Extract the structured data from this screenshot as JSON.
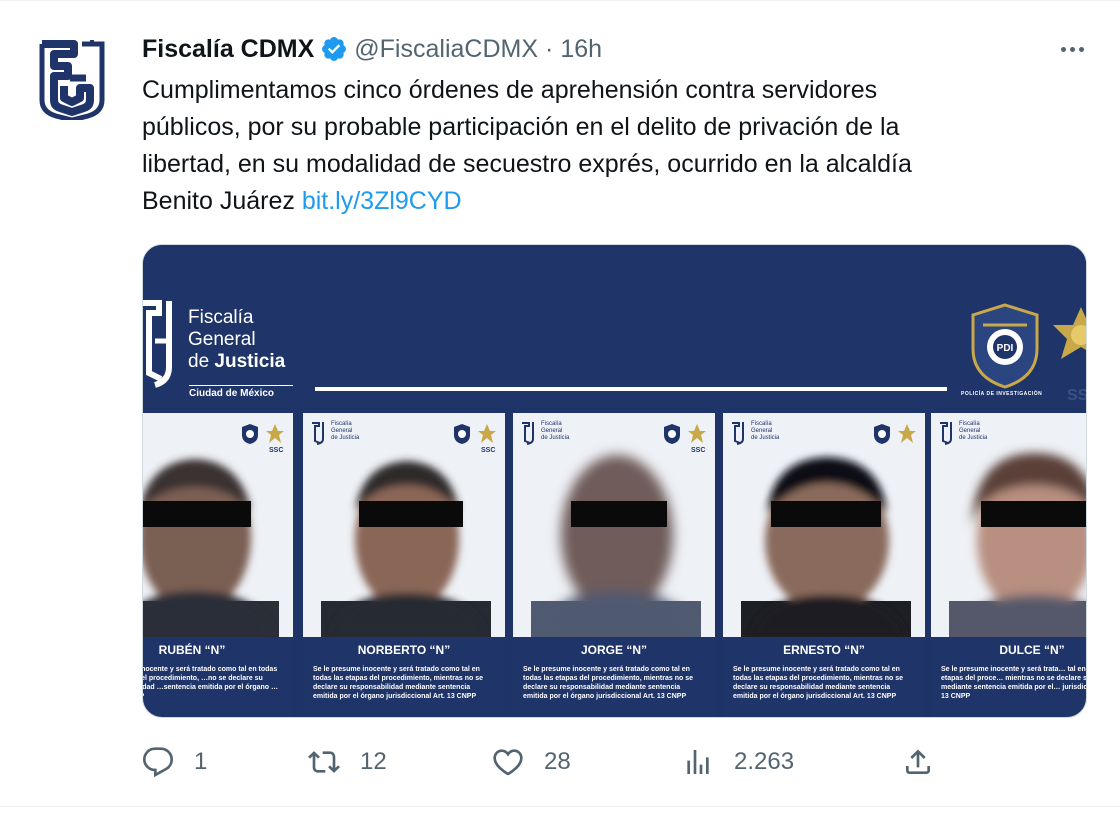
{
  "tweet": {
    "display_name": "Fiscalía CDMX",
    "handle": "@FiscaliaCDMX",
    "separator": "·",
    "time": "16h",
    "verified_icon": "verified-badge-icon",
    "avatar_icon": "fiscalia-fgj-logo",
    "text_lines": [
      "Cumplimentamos cinco órdenes de aprehensión contra servidores",
      "públicos, por su probable participación en el delito de privación de la",
      "libertad, en su modalidad de secuestro exprés, ocurrido en la alcaldía"
    ],
    "text_last_prefix": "Benito Juárez ",
    "link_text": "bit.ly/3Zl9CYD",
    "colors": {
      "link": "#1d9bf0",
      "verified": "#1d9bf0",
      "muted": "#536471",
      "banner": "#1f3468"
    }
  },
  "media": {
    "banner": {
      "org_line1": "Fiscalía",
      "org_line2": "General",
      "org_line3_prefix": "de ",
      "org_line3_bold": "Justicia",
      "org_sub": "Ciudad de México",
      "pdi_caption": "POLICÍA DE INVESTIGACIÓN",
      "ssc": "SS"
    },
    "cards": [
      {
        "name": "RUBÉN “N”",
        "legal": "…presume inocente y será tratado como tal en todas las etapas del procedimiento, …no se declare su responsabilidad …sentencia emitida por el órgano …Art. 13 CNPP"
      },
      {
        "name": "NORBERTO “N”",
        "legal": "Se le presume inocente y será tratado como tal en todas las etapas del procedimiento, mientras no se declare su responsabilidad mediante sentencia emitida por el órgano jurisdiccional Art. 13 CNPP"
      },
      {
        "name": "JORGE “N”",
        "legal": "Se le presume inocente y será tratado como tal en todas las etapas del procedimiento, mientras no se declare su responsabilidad mediante sentencia emitida por el órgano jurisdiccional Art. 13 CNPP"
      },
      {
        "name": "ERNESTO “N”",
        "legal": "Se le presume inocente y será tratado como tal en todas las etapas del procedimiento, mientras no se declare su responsabilidad mediante sentencia emitida por el órgano jurisdiccional Art. 13 CNPP"
      },
      {
        "name": "DULCE “N”",
        "legal": "Se le presume inocente y será trata… tal en todas las etapas del proce… mientras no se declare surespon… mediante sentencia emitida por el… jurisdiccional Art. 13 CNPP"
      }
    ],
    "card_header": {
      "line1": "Fiscalía",
      "line2": "General",
      "line3": "de Justicia",
      "ssc": "SSC"
    }
  },
  "actions": {
    "reply": {
      "icon": "reply-icon",
      "count": "1"
    },
    "retweet": {
      "icon": "retweet-icon",
      "count": "12"
    },
    "like": {
      "icon": "heart-icon",
      "count": "28"
    },
    "views": {
      "icon": "views-chart-icon",
      "count": "2.263"
    },
    "share": {
      "icon": "share-icon"
    }
  }
}
